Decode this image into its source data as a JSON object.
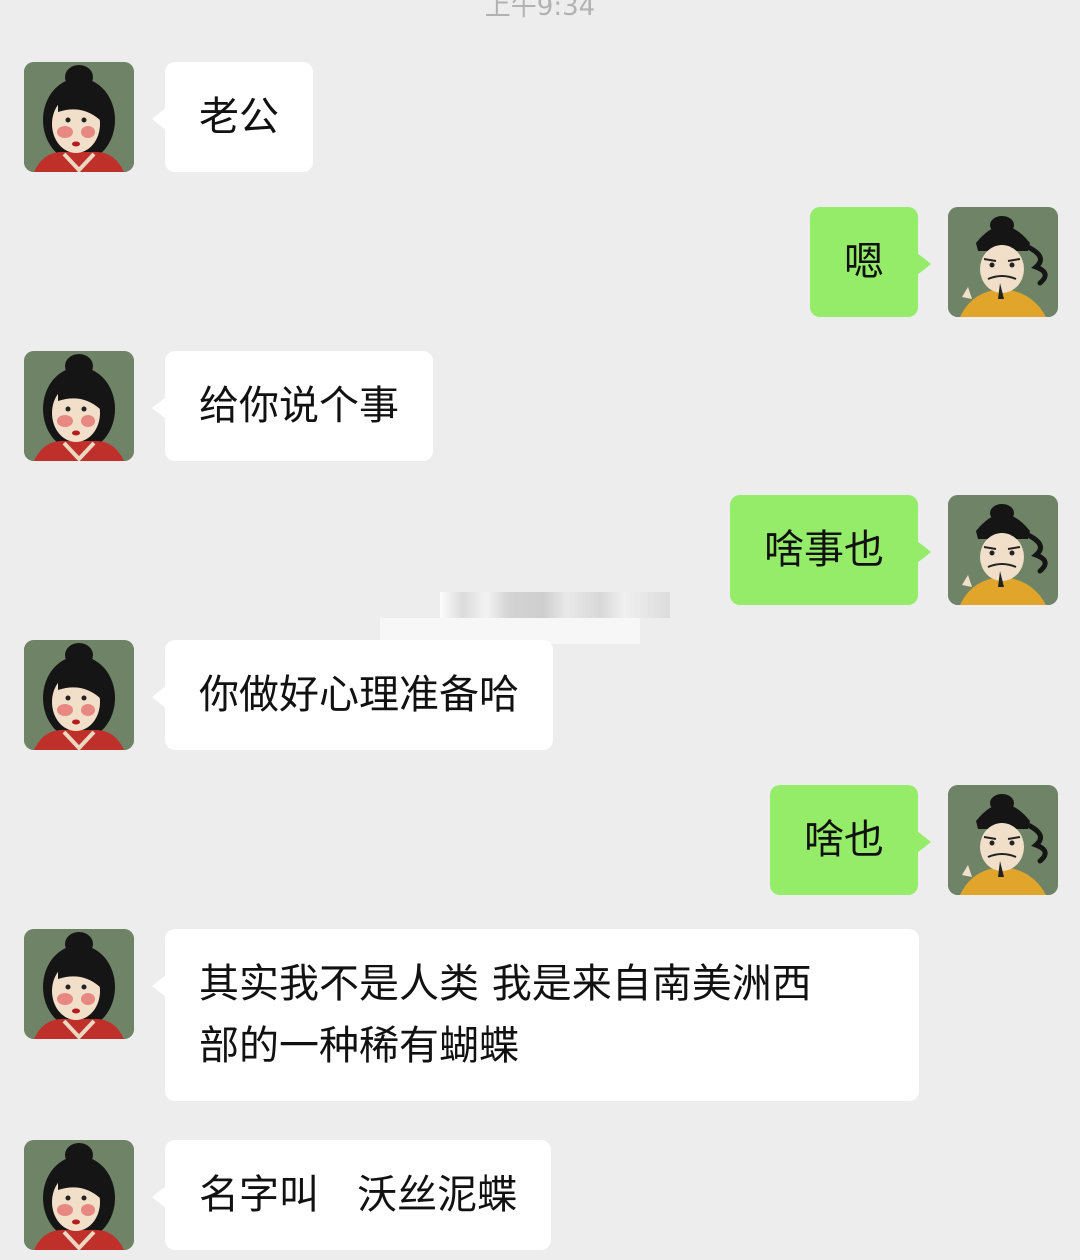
{
  "status": {
    "timestamp": "上午9:34"
  },
  "avatars": {
    "wife": "woman-portrait-icon",
    "husband": "man-portrait-icon"
  },
  "colors": {
    "background": "#ededed",
    "received_bubble": "#ffffff",
    "sent_bubble": "#95ec69"
  },
  "messages": [
    {
      "sender": "wife",
      "text": "老公"
    },
    {
      "sender": "husband",
      "text": "嗯"
    },
    {
      "sender": "wife",
      "text": "给你说个事"
    },
    {
      "sender": "husband",
      "text": "啥事也"
    },
    {
      "sender": "wife",
      "text": "你做好心理准备哈"
    },
    {
      "sender": "husband",
      "text": "啥也"
    },
    {
      "sender": "wife",
      "text": "其实我不是人类 我是来自南美洲西\n部的一种稀有蝴蝶"
    },
    {
      "sender": "wife",
      "text": "名字叫   沃丝泥蝶"
    }
  ]
}
